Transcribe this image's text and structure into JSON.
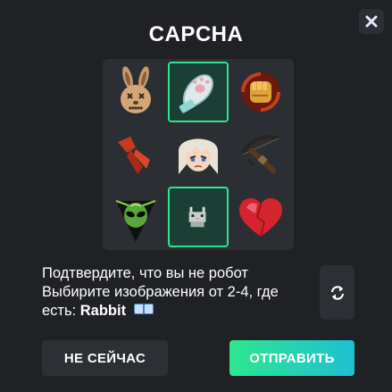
{
  "captcha": {
    "title": "CAPCHA",
    "prompt_line1": "Подтвердите, что вы не робот",
    "prompt_line2": "Выбирите изображения от 2-4, где",
    "prompt_line3_prefix": "есть:",
    "target_word": "Rabbit",
    "selected_count": 2,
    "tiles": [
      {
        "icon": "stitched-rabbit-doll-icon",
        "selected": false
      },
      {
        "icon": "rabbit-paw-icon",
        "selected": true
      },
      {
        "icon": "fist-icon",
        "selected": false
      },
      {
        "icon": "red-scarf-icon",
        "selected": false
      },
      {
        "icon": "anime-character-face-icon",
        "selected": false
      },
      {
        "icon": "crossbow-icon",
        "selected": false
      },
      {
        "icon": "alien-head-icon",
        "selected": false
      },
      {
        "icon": "pixel-rabbit-icon",
        "selected": true
      },
      {
        "icon": "red-heart-icon",
        "selected": false
      }
    ]
  },
  "buttons": {
    "not_now": "НЕ СЕЙЧАС",
    "submit": "ОТПРАВИТЬ"
  },
  "colors": {
    "background": "#1f2124",
    "grid_background": "#2b2e32",
    "selected_border": "#2ee68f",
    "submit_gradient_start": "#2ee68f",
    "submit_gradient_end": "#1fbfd2"
  }
}
